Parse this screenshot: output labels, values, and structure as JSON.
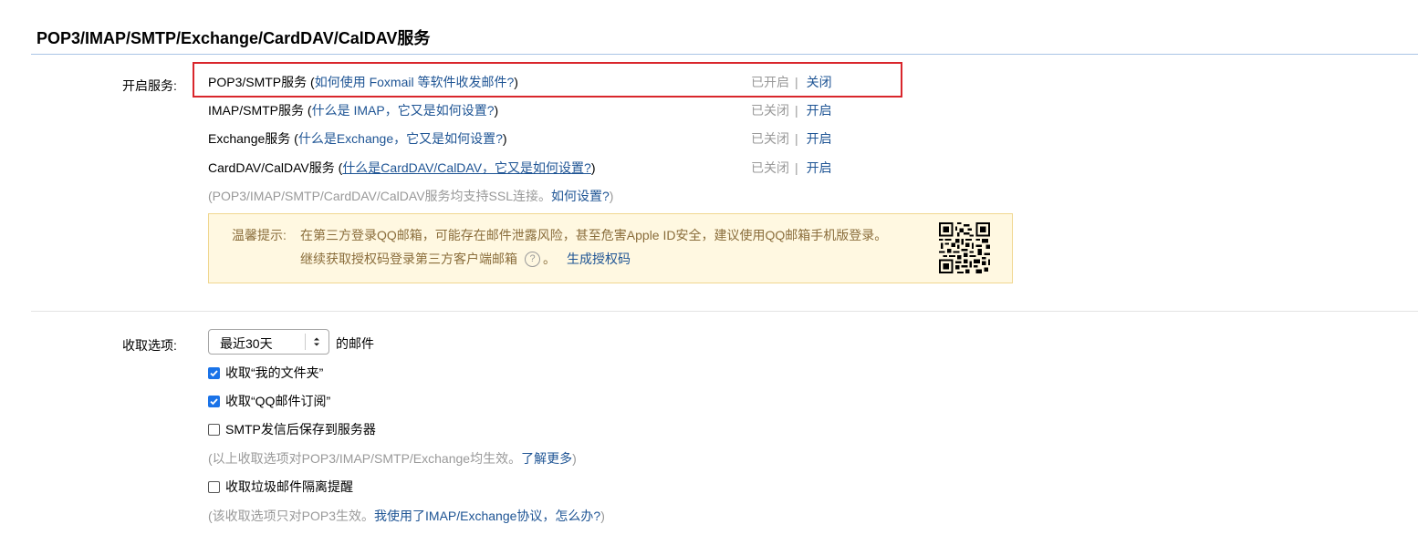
{
  "page_title": "POP3/IMAP/SMTP/Exchange/CardDAV/CalDAV服务",
  "services_label": "开启服务:",
  "services": [
    {
      "name": "POP3/SMTP服务",
      "open": "(",
      "help": "如何使用 Foxmail 等软件收发邮件?",
      "close": ")",
      "status": "已开启",
      "divider": "|",
      "action": "关闭",
      "highlighted": true
    },
    {
      "name": "IMAP/SMTP服务",
      "open": "(",
      "help": "什么是 IMAP，它又是如何设置?",
      "close": ")",
      "status": "已关闭",
      "divider": "|",
      "action": "开启"
    },
    {
      "name": "Exchange服务",
      "open": "(",
      "help": "什么是Exchange，它又是如何设置?",
      "close": ")",
      "status": "已关闭",
      "divider": "|",
      "action": "开启"
    },
    {
      "name": "CardDAV/CalDAV服务",
      "open": "(",
      "help": "什么是CardDAV/CalDAV，它又是如何设置?",
      "close": ")",
      "status": "已关闭",
      "divider": "|",
      "action": "开启"
    }
  ],
  "ssl_note": {
    "prefix": "(POP3/IMAP/SMTP/CardDAV/CalDAV服务均支持SSL连接。",
    "link": "如何设置?",
    "suffix": ")"
  },
  "tip": {
    "label": "温馨提示:",
    "line1": "在第三方登录QQ邮箱，可能存在邮件泄露风险，甚至危害Apple ID安全，建议使用QQ邮箱手机版登录。",
    "line2": "继续获取授权码登录第三方客户端邮箱",
    "help_glyph": "?",
    "line2_end": "。",
    "generate_link": "生成授权码"
  },
  "fetch_label": "收取选项:",
  "fetch_select": {
    "value": "最近30天",
    "suffix": "的邮件"
  },
  "checkboxes": [
    {
      "label": "收取“我的文件夹”",
      "checked": true
    },
    {
      "label": "收取“QQ邮件订阅”",
      "checked": true
    },
    {
      "label": "SMTP发信后保存到服务器",
      "checked": false
    },
    {
      "label": "收取垃圾邮件隔离提醒",
      "checked": false
    }
  ],
  "note1": {
    "prefix": "(以上收取选项对POP3/IMAP/SMTP/Exchange均生效。",
    "link": "了解更多",
    "suffix": ")"
  },
  "note2": {
    "prefix": "(该收取选项只对POP3生效。",
    "link": "我使用了IMAP/Exchange协议，怎么办?",
    "suffix": ")"
  },
  "colors": {
    "link": "#1e5494",
    "highlight_border": "#d9262c",
    "checkbox": "#1a73e8",
    "tip_bg": "#fff8e1"
  }
}
